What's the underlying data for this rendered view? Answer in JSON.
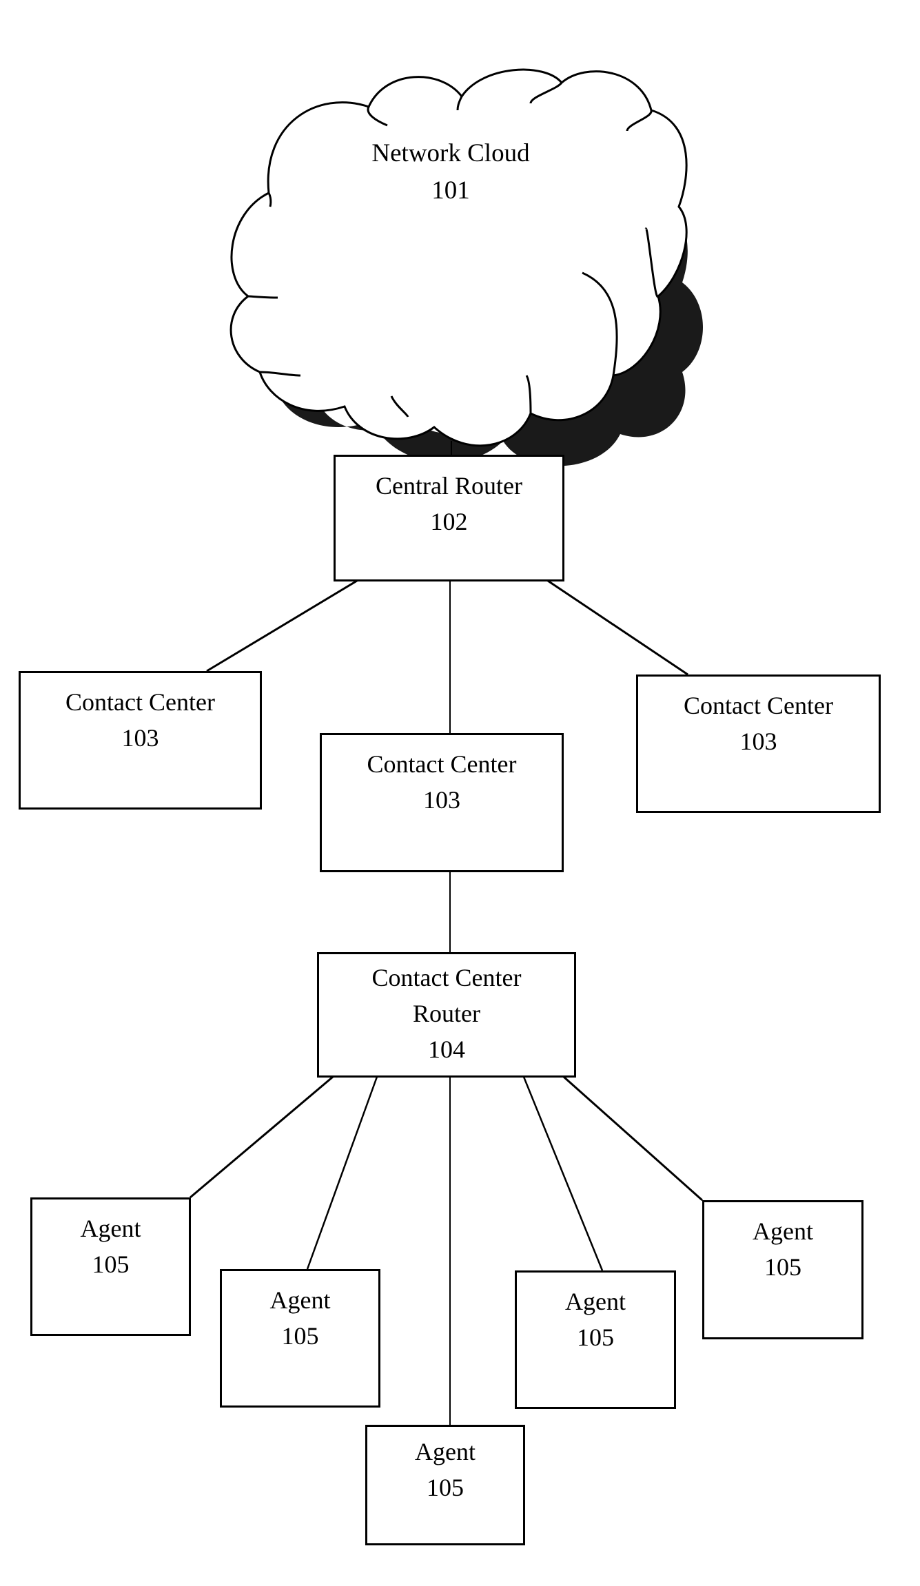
{
  "diagram": {
    "type": "network-topology",
    "nodes": [
      {
        "id": "network-cloud",
        "title": "Network Cloud",
        "ref": "101",
        "shape": "cloud"
      },
      {
        "id": "central-router",
        "title": "Central Router",
        "ref": "102",
        "shape": "box"
      },
      {
        "id": "contact-center-left",
        "title": "Contact Center",
        "ref": "103",
        "shape": "box"
      },
      {
        "id": "contact-center-middle",
        "title": "Contact Center",
        "ref": "103",
        "shape": "box"
      },
      {
        "id": "contact-center-right",
        "title": "Contact Center",
        "ref": "103",
        "shape": "box"
      },
      {
        "id": "contact-center-router",
        "title_line1": "Contact Center",
        "title_line2": "Router",
        "ref": "104",
        "shape": "box"
      },
      {
        "id": "agent-1",
        "title": "Agent",
        "ref": "105",
        "shape": "box"
      },
      {
        "id": "agent-2",
        "title": "Agent",
        "ref": "105",
        "shape": "box"
      },
      {
        "id": "agent-3",
        "title": "Agent",
        "ref": "105",
        "shape": "box"
      },
      {
        "id": "agent-4",
        "title": "Agent",
        "ref": "105",
        "shape": "box"
      },
      {
        "id": "agent-5",
        "title": "Agent",
        "ref": "105",
        "shape": "box"
      }
    ],
    "edges": [
      [
        "network-cloud",
        "central-router"
      ],
      [
        "central-router",
        "contact-center-left"
      ],
      [
        "central-router",
        "contact-center-middle"
      ],
      [
        "central-router",
        "contact-center-right"
      ],
      [
        "contact-center-middle",
        "contact-center-router"
      ],
      [
        "contact-center-router",
        "agent-1"
      ],
      [
        "contact-center-router",
        "agent-2"
      ],
      [
        "contact-center-router",
        "agent-3"
      ],
      [
        "contact-center-router",
        "agent-4"
      ],
      [
        "contact-center-router",
        "agent-5"
      ]
    ]
  }
}
